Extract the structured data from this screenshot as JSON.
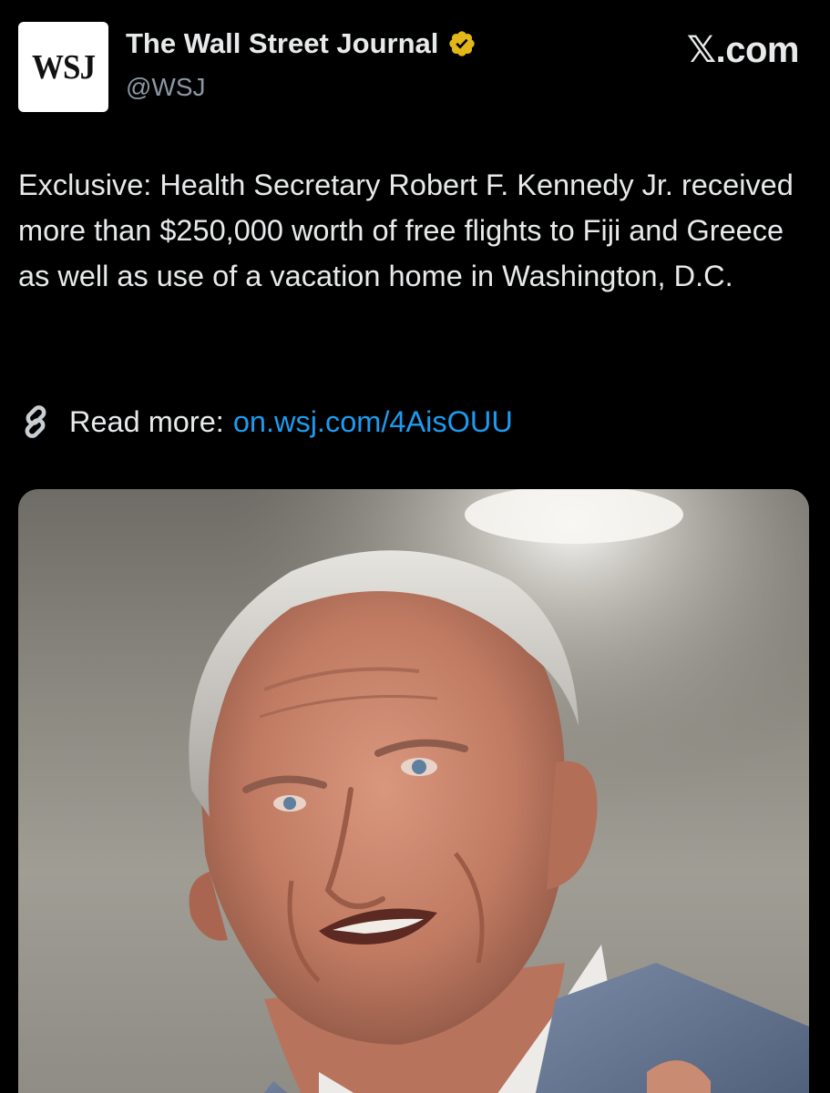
{
  "post": {
    "author": {
      "display_name": "The Wall Street Journal",
      "handle": "@WSJ",
      "avatar_text": "WSJ",
      "verified_icon": "verified-gold-badge-icon",
      "verified_color": "#e2b719"
    },
    "brand_watermark": "𝕏.com",
    "text": "Exclusive: Health Secretary Robert F. Kennedy Jr. received more than $250,000 worth of free flights to Fiji and Greece as well as use of a vacation home in Washington, D.C.",
    "read_more": {
      "icon": "link-icon",
      "label": "Read more:",
      "url_text": "on.wsj.com/4AisOUU"
    },
    "media": {
      "icon": "photo-of-gray-haired-man-in-suit"
    }
  },
  "colors": {
    "background": "#000000",
    "text_primary": "#e7e9ea",
    "text_secondary": "#8b98a5",
    "link": "#1d9bf0"
  }
}
